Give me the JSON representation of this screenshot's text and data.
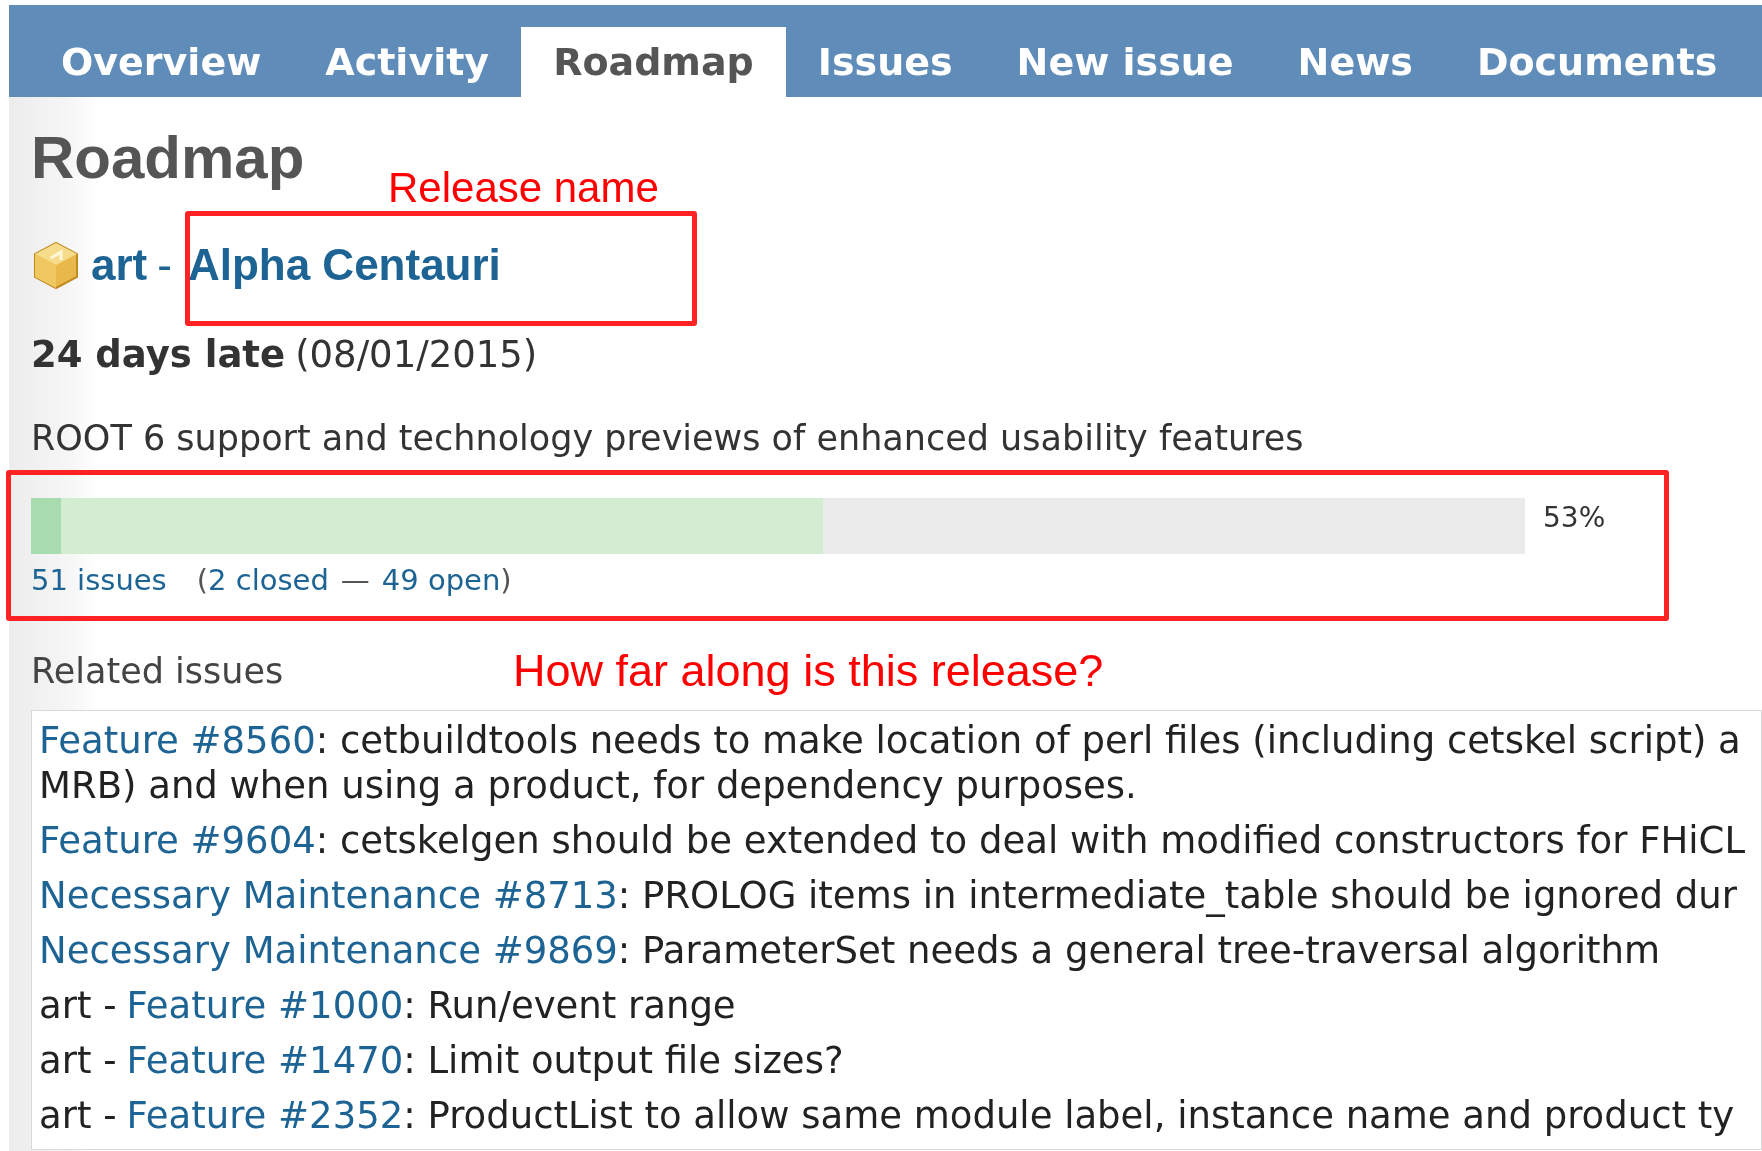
{
  "tabs": [
    {
      "label": "Overview",
      "selected": false
    },
    {
      "label": "Activity",
      "selected": false
    },
    {
      "label": "Roadmap",
      "selected": true
    },
    {
      "label": "Issues",
      "selected": false
    },
    {
      "label": "New issue",
      "selected": false
    },
    {
      "label": "News",
      "selected": false
    },
    {
      "label": "Documents",
      "selected": false
    }
  ],
  "heading": "Roadmap",
  "version": {
    "project": "art",
    "separator": "-",
    "name": "Alpha Centauri",
    "late": "24 days late",
    "date": "(08/01/2015)",
    "description": "ROOT 6 support and technology previews of enhanced usability features"
  },
  "progress": {
    "closed": {
      "level": 0.02
    },
    "done": {
      "level": 0.53
    },
    "percent": "53%"
  },
  "stats": [
    {
      "text": "51 issues",
      "kind": "link"
    },
    {
      "text": "(",
      "kind": "plain"
    },
    {
      "text": "2 closed",
      "kind": "link"
    },
    {
      "text": "—",
      "kind": "plain"
    },
    {
      "text": "49 open",
      "kind": "link"
    },
    {
      "text": ")",
      "kind": "plain"
    }
  ],
  "related_heading": "Related issues",
  "issues": [
    {
      "link": "Feature #8560",
      "lines": [
        ": cetbuildtools needs to make location of perl files (including cetskel script) a",
        "MRB) and when using a product, for dependency purposes."
      ]
    },
    {
      "link": "Feature #9604",
      "lines": [
        ": cetskelgen should be extended to deal with modified constructors for FHiCL"
      ]
    },
    {
      "link": "Necessary Maintenance #8713",
      "lines": [
        ": PROLOG items in intermediate_table should be ignored dur"
      ]
    },
    {
      "link": "Necessary Maintenance #9869",
      "lines": [
        ": ParameterSet needs a general tree-traversal algorithm"
      ]
    },
    {
      "project": "art -",
      "link": "Feature #1000",
      "lines": [
        ": Run/event range"
      ]
    },
    {
      "project": "art -",
      "link": "Feature #1470",
      "lines": [
        ": Limit output file sizes?"
      ]
    },
    {
      "project": "art -",
      "link": "Feature #2352",
      "lines": [
        ": ProductList to allow same module label, instance name and product ty"
      ]
    }
  ],
  "annotations": [
    {
      "kind": "label",
      "text": "Release name"
    },
    {
      "kind": "label",
      "text": "How far along is this release?"
    }
  ]
}
